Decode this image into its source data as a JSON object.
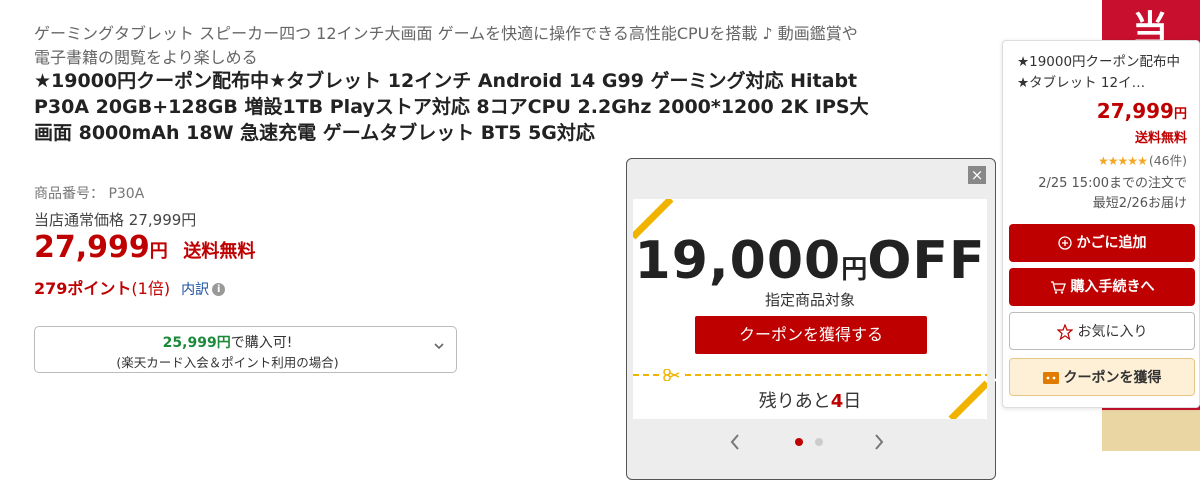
{
  "product": {
    "catchcopy": "ゲーミングタブレット スピーカー四つ 12インチ大画面 ゲームを快適に操作できる高性能CPUを搭載 ♪ 動画鑑賞や電子書籍の閲覧をより楽しめる",
    "title": "★19000円クーポン配布中★タブレット 12インチ Android 14 G99 ゲーミング対応 Hitabt P30A 20GB+128GB 増設1TB Playストア対応 8コアCPU 2.2Ghz 2000*1200 2K IPS大画面 8000mAh 18W 急速充電 ゲームタブレット BT5 5G対応",
    "item_number_label": "商品番号：",
    "item_number": "P30A",
    "normal_price_label": "当店通常価格",
    "normal_price": "27,999円",
    "price": "27,999",
    "price_unit": "円",
    "shipping": "送料無料",
    "points": "279ポイント",
    "points_multiplier": "(1倍)",
    "breakdown_link": "内訳",
    "info_icon_glyph": "i"
  },
  "card_offer": {
    "price": "25,999円",
    "suffix": "で購入可!",
    "condition": "(楽天カード入会＆ポイント利用の場合)"
  },
  "coupon_popup": {
    "close_glyph": "×",
    "amount": "19,000",
    "yen": "円",
    "off": "OFF",
    "target": "指定商品対象",
    "button": "クーポンを獲得する",
    "remain_prefix": "残りあと",
    "remain_days": "4",
    "remain_suffix": "日",
    "prev_glyph": "‹",
    "next_glyph": "›"
  },
  "side_panel": {
    "title": "★19000円クーポン配布中★タブレット 12イ…",
    "price": "27,999",
    "price_unit": "円",
    "shipping": "送料無料",
    "stars": "★★★★★",
    "rating_count": "(46件)",
    "delivery_line1": "2/25 15:00までの注文で",
    "delivery_line2": "最短2/26お届け",
    "cart_button": "かごに追加",
    "checkout_button": "購入手続きへ",
    "favorite_button": "お気に入り",
    "coupon_button": "クーポンを獲得"
  },
  "edge_banner": {
    "char": "当"
  },
  "colors": {
    "rakuten_red": "#bf0000",
    "green": "#1c8a3a",
    "coupon_yellow": "#f0b400",
    "star": "#f5a623"
  }
}
